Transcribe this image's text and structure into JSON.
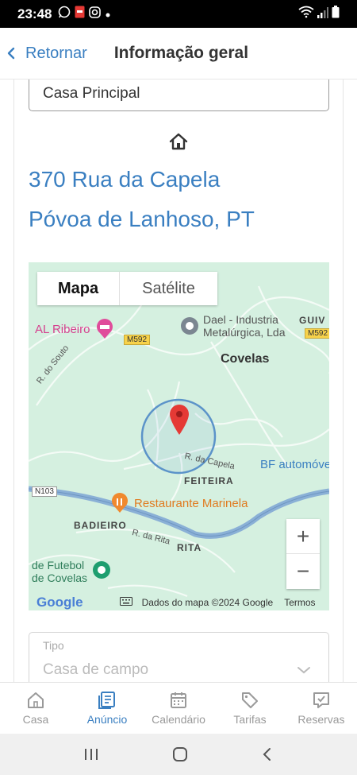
{
  "status_bar": {
    "time": "23:48"
  },
  "header": {
    "back_label": "Retornar",
    "title": "Informação geral"
  },
  "property": {
    "name": "Casa Principal",
    "address_line1": "370 Rua da Capela",
    "address_line2": "Póvoa de Lanhoso, PT"
  },
  "map": {
    "tab_map": "Mapa",
    "tab_satellite": "Satélite",
    "labels": {
      "al_ribeiro": "AL Ribeiro",
      "dael_1": "Dael - Industria",
      "dael_2": "Metalúrgica, Lda",
      "guiv": "GUIV",
      "covelas": "Covelas",
      "r_souto": "R. do Souto",
      "r_capela": "R. da Capela",
      "bf": "BF automóve",
      "feiteira": "FEITEIRA",
      "restaurante": "Restaurante Marinela",
      "badieiro": "BADIEIRO",
      "r_rita": "R. da Rita",
      "rita": "RITA",
      "futebol_1": "de Futebol",
      "futebol_2": "de Covelas",
      "road_m592": "M592",
      "road_n103": "N103"
    },
    "zoom_in": "+",
    "zoom_out": "−",
    "google": "Google",
    "attribution": "Dados do mapa ©2024 Google",
    "terms": "Termos"
  },
  "type_field": {
    "label": "Tipo",
    "value": "Casa de campo"
  },
  "bottom_nav": [
    {
      "label": "Casa"
    },
    {
      "label": "Anúncio"
    },
    {
      "label": "Calendário"
    },
    {
      "label": "Tarifas"
    },
    {
      "label": "Reservas"
    }
  ],
  "colors": {
    "accent": "#3a7fc1",
    "map_bg": "#d5f0e0",
    "pin": "#e53935"
  }
}
